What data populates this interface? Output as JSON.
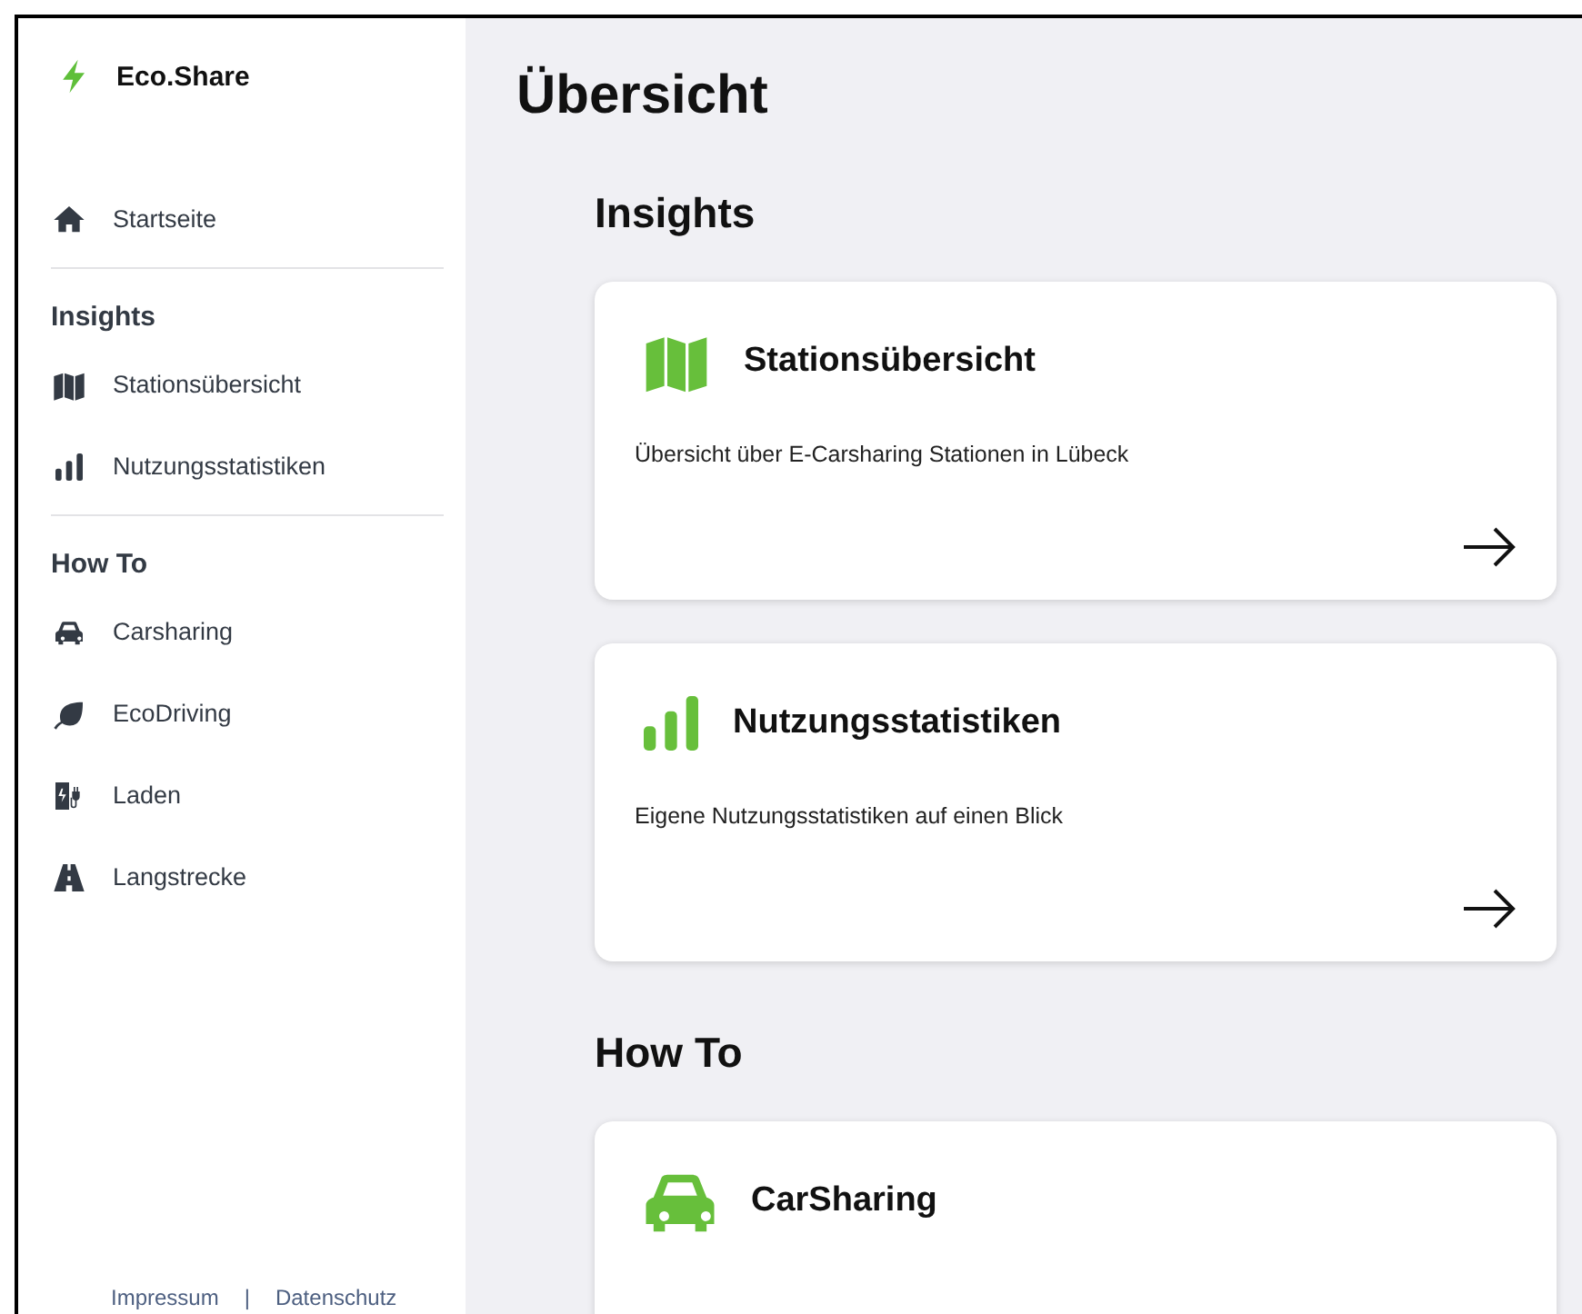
{
  "sidebar": {
    "brand": "Eco.Share",
    "top_items": [
      {
        "label": "Startseite"
      }
    ],
    "groups": [
      {
        "heading": "Insights",
        "items": [
          {
            "label": "Stationsübersicht"
          },
          {
            "label": "Nutzungsstatistiken"
          }
        ]
      },
      {
        "heading": "How To",
        "items": [
          {
            "label": "Carsharing"
          },
          {
            "label": "EcoDriving"
          },
          {
            "label": "Laden"
          },
          {
            "label": "Langstrecke"
          }
        ]
      }
    ],
    "footer": {
      "links": [
        "Impressum",
        "Datenschutz"
      ],
      "separator": "|"
    }
  },
  "main": {
    "title": "Übersicht",
    "sections": [
      {
        "heading": "Insights",
        "cards": [
          {
            "title": "Stationsübersicht",
            "description": "Übersicht über E-Carsharing Stationen in Lübeck",
            "kind": "map"
          },
          {
            "title": "Nutzungsstatistiken",
            "description": "Eigene Nutzungsstatistiken auf einen Blick",
            "kind": "chart"
          }
        ]
      },
      {
        "heading": "How To",
        "cards": [
          {
            "title": "CarSharing",
            "kind": "car"
          }
        ]
      }
    ]
  }
}
